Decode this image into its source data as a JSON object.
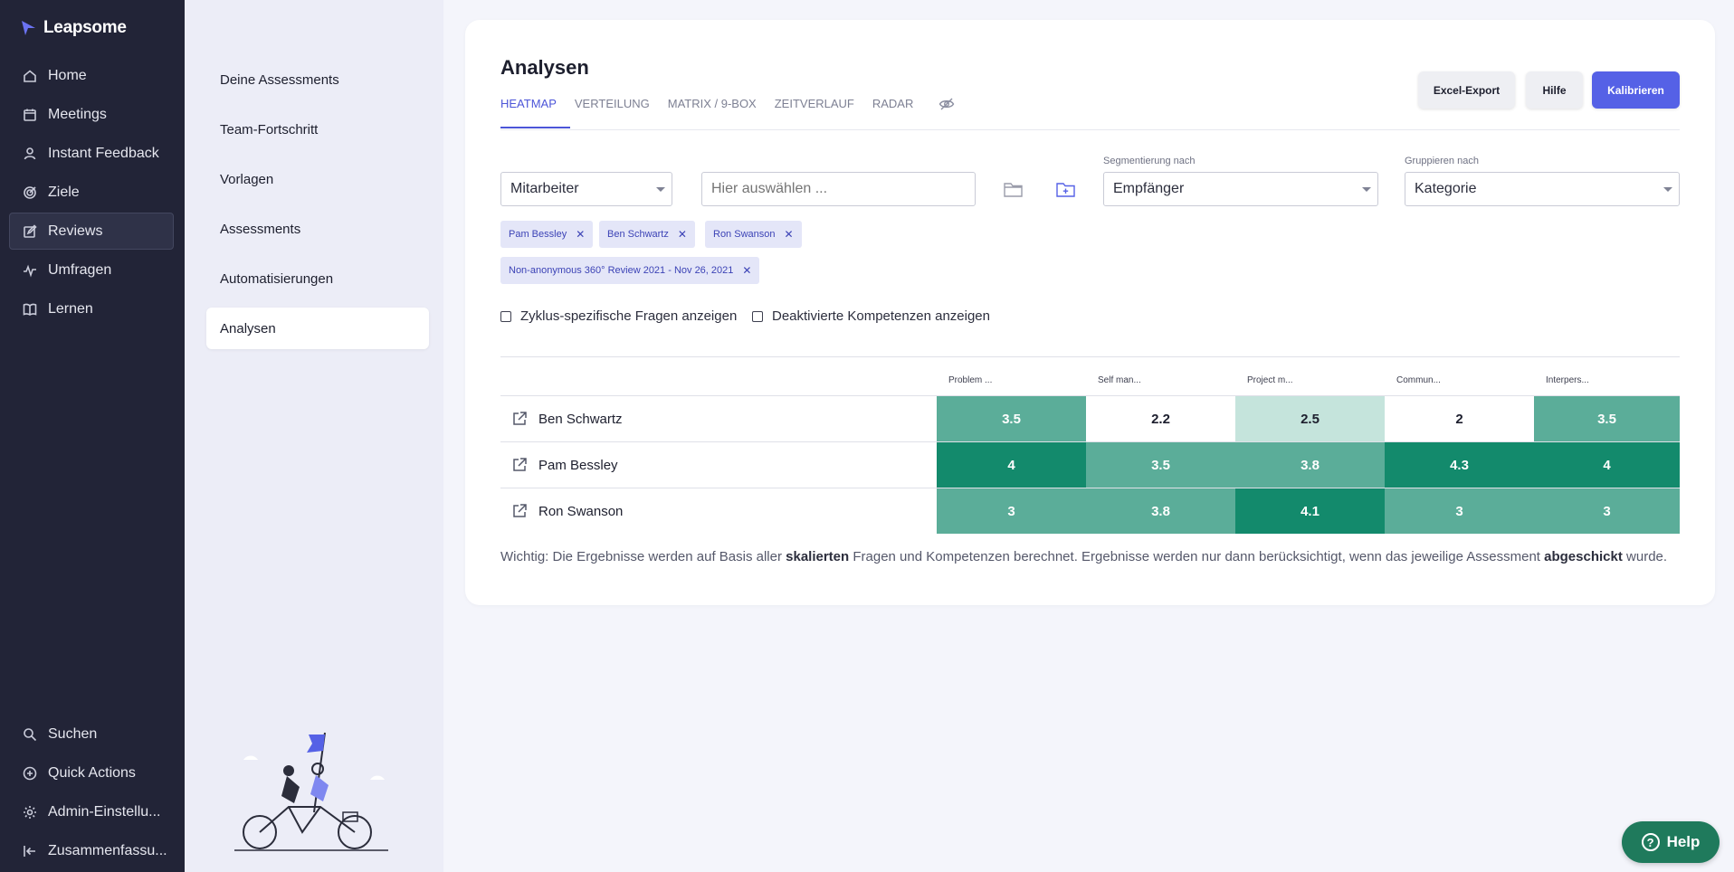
{
  "app": {
    "brand": "Leapsome"
  },
  "sidebar": {
    "items": [
      {
        "label": "Home",
        "icon": "home-icon"
      },
      {
        "label": "Meetings",
        "icon": "meetings-icon"
      },
      {
        "label": "Instant Feedback",
        "icon": "feedback-icon"
      },
      {
        "label": "Ziele",
        "icon": "target-icon"
      },
      {
        "label": "Reviews",
        "icon": "review-icon",
        "active": true
      },
      {
        "label": "Umfragen",
        "icon": "pulse-icon"
      },
      {
        "label": "Lernen",
        "icon": "book-icon"
      }
    ],
    "bottom": [
      {
        "label": "Suchen",
        "icon": "search-icon"
      },
      {
        "label": "Quick Actions",
        "icon": "plus-circle-icon"
      },
      {
        "label": "Admin-Einstellu...",
        "icon": "gear-icon"
      },
      {
        "label": "Zusammenfassu...",
        "icon": "collapse-icon"
      }
    ]
  },
  "subnav": {
    "items": [
      {
        "label": "Deine Assessments"
      },
      {
        "label": "Team-Fortschritt"
      },
      {
        "label": "Vorlagen"
      },
      {
        "label": "Assessments"
      },
      {
        "label": "Automatisierungen"
      },
      {
        "label": "Analysen",
        "active": true
      }
    ]
  },
  "main": {
    "title": "Analysen",
    "tabs": [
      "HEATMAP",
      "VERTEILUNG",
      "MATRIX / 9-BOX",
      "ZEITVERLAUF",
      "RADAR"
    ],
    "active_tab": "HEATMAP",
    "buttons": {
      "export": "Excel-Export",
      "help": "Hilfe",
      "calibrate": "Kalibrieren"
    },
    "filters": {
      "type_select": "Mitarbeiter",
      "search_placeholder": "Hier auswählen ...",
      "segment_label": "Segmentierung nach",
      "segment_value": "Empfänger",
      "group_label": "Gruppieren nach",
      "group_value": "Kategorie"
    },
    "chips": [
      "Pam Bessley",
      "Ben Schwartz",
      "Ron Swanson"
    ],
    "cycle_chip": "Non-anonymous 360° Review 2021 - Nov 26, 2021",
    "checkboxes": {
      "cycle_questions": "Zyklus-spezifische Fragen anzeigen",
      "deactivated": "Deaktivierte Kompetenzen anzeigen"
    },
    "heatmap": {
      "columns": [
        "Problem ...",
        "Self man...",
        "Project m...",
        "Commun...",
        "Interpers..."
      ],
      "rows": [
        {
          "name": "Ben Schwartz",
          "values": [
            "3.5",
            "2.2",
            "2.5",
            "2",
            "3.5"
          ]
        },
        {
          "name": "Pam Bessley",
          "values": [
            "4",
            "3.5",
            "3.8",
            "4.3",
            "4"
          ]
        },
        {
          "name": "Ron Swanson",
          "values": [
            "3",
            "3.8",
            "4.1",
            "3",
            "3"
          ]
        }
      ]
    },
    "note": {
      "part1": "Wichtig: Die Ergebnisse werden auf Basis aller ",
      "bold1": "skalierten",
      "part2": " Fragen und Kompetenzen berechnet. Ergebnisse werden nur dann berücksichtigt, wenn das jeweilige Assessment ",
      "bold2": "abgeschickt",
      "part3": " wurde."
    }
  },
  "help_widget": {
    "label": "Help"
  },
  "colors": {
    "accent": "#5561e6",
    "heat_low": "#ffffff",
    "heat_mid_light": "#c5e4dc",
    "heat_mid": "#5bad99",
    "heat_high": "#138a6c"
  }
}
